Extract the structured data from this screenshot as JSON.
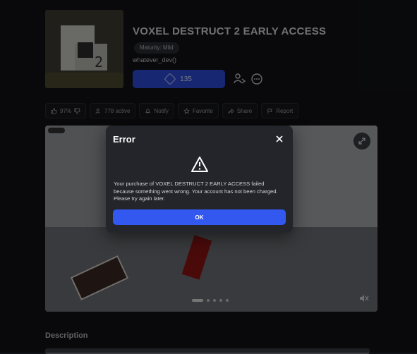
{
  "experience": {
    "title": "VOXEL DESTRUCT 2 EARLY ACCESS",
    "maturity": "Maturity: Mild",
    "creator": "whatever_dev()",
    "price": "135"
  },
  "stats": {
    "like_pct": "97%",
    "active": "778 active",
    "notify": "Notify",
    "favorite": "Favorite",
    "share": "Share",
    "report": "Report"
  },
  "media": {
    "slide_count": 5,
    "active_slide": 1
  },
  "description": {
    "heading": "Description"
  },
  "dialog": {
    "title": "Error",
    "message": "Your purchase of VOXEL DESTRUCT 2 EARLY ACCESS failed because something went wrong. Your account has not been charged. Please try again later.",
    "ok_label": "OK"
  },
  "colors": {
    "accent": "#3358f0",
    "buy_button": "#2d4bd8",
    "background": "#121316"
  }
}
